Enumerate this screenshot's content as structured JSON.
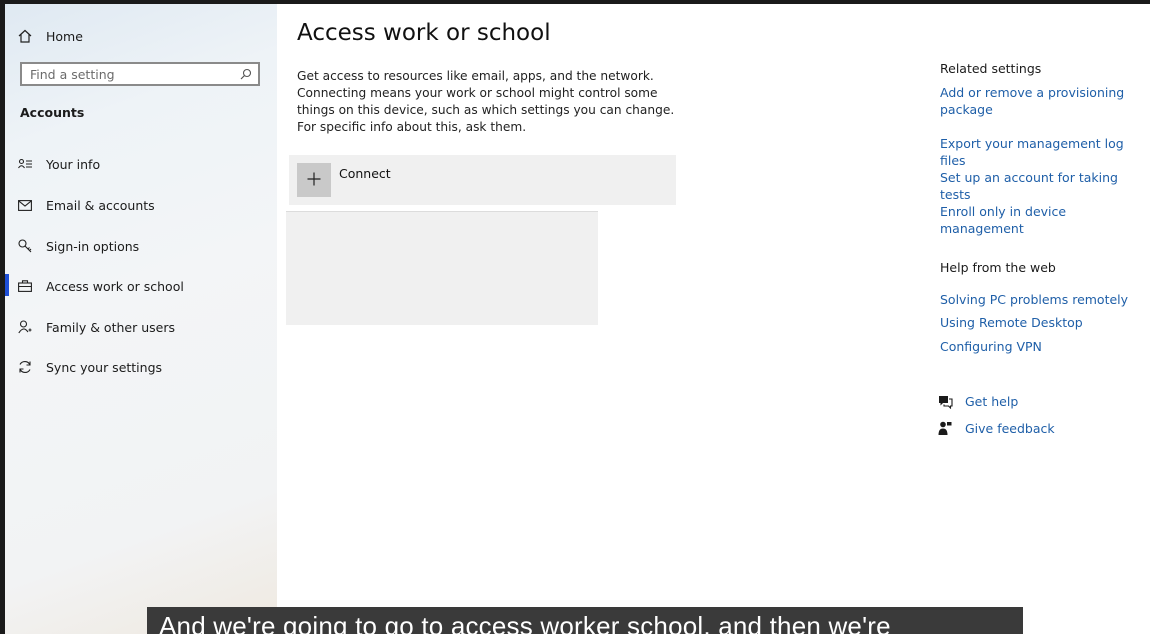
{
  "sidebar": {
    "home_label": "Home",
    "search_placeholder": "Find a setting",
    "section_title": "Accounts",
    "items": [
      {
        "label": "Your info",
        "icon": "person-card-icon"
      },
      {
        "label": "Email & accounts",
        "icon": "mail-icon"
      },
      {
        "label": "Sign-in options",
        "icon": "key-icon"
      },
      {
        "label": "Access work or school",
        "icon": "briefcase-icon",
        "active": true
      },
      {
        "label": "Family & other users",
        "icon": "person-add-icon"
      },
      {
        "label": "Sync your settings",
        "icon": "sync-icon"
      }
    ]
  },
  "main": {
    "title": "Access work or school",
    "description": "Get access to resources like email, apps, and the network. Connecting means your work or school might control some things on this device, such as which settings you can change. For specific info about this, ask them.",
    "connect_label": "Connect"
  },
  "related": {
    "heading": "Related settings",
    "links": [
      "Add or remove a provisioning package",
      "Export your management log files",
      "Set up an account for taking tests",
      "Enroll only in device management"
    ]
  },
  "help": {
    "heading": "Help from the web",
    "links": [
      "Solving PC problems remotely",
      "Using Remote Desktop",
      "Configuring VPN"
    ],
    "get_help": "Get help",
    "give_feedback": "Give feedback"
  },
  "caption": {
    "text": "And we're going to go to access worker school, and then we're"
  },
  "colors": {
    "accent": "#1e4fd6",
    "link": "#1f5fa8",
    "caption_bg": "#3a3a3a"
  }
}
